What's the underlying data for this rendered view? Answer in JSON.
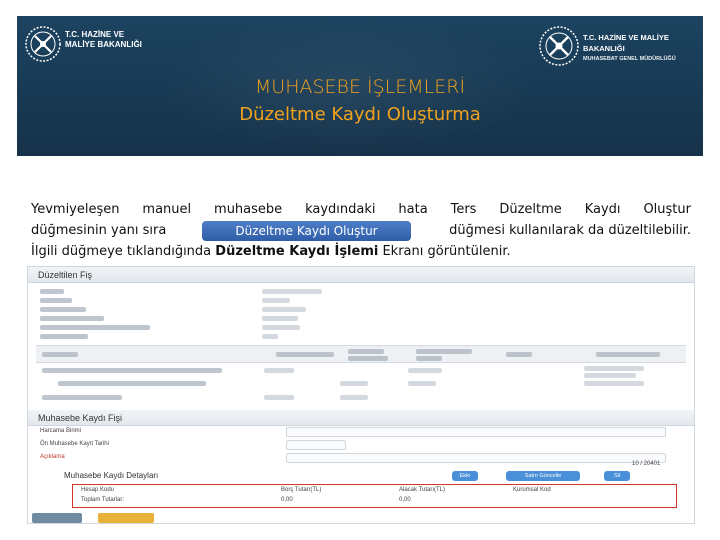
{
  "header": {
    "left_ministry_line1": "T.C. HAZİNE VE",
    "left_ministry_line2": "MALİYE BAKANLIĞI",
    "right_ministry_line1": "T.C. HAZİNE VE MALİYE BAKANLIĞI",
    "right_ministry_line2": "MUHASEBAT GENEL MÜDÜRLÜĞÜ",
    "title": "MUHASEBE İŞLEMLERİ",
    "subtitle": "Düzeltme Kaydı Oluşturma",
    "colors": {
      "band": "#18374f",
      "title": "#f0a21c"
    }
  },
  "paragraph": {
    "line1_words": [
      "Yevmiyeleşen",
      "manuel",
      "muhasebe",
      "kaydındaki",
      "hata",
      "Ters",
      "Düzeltme",
      "Kaydı",
      "Oluştur"
    ],
    "line2_left": "düğmesinin yanı sıra",
    "button_label": "Düzeltme Kaydı Oluştur",
    "line2_right": "düğmesi kullanılarak da düzeltilebilir.",
    "line3_pre": "İlgili düğmeye tıklandığında ",
    "line3_bold": "Düzeltme Kaydı İşlemi",
    "line3_post": " Ekranı görüntülenir."
  },
  "screenshot": {
    "section1_title": "Düzeltilen Fiş",
    "section2_title": "Muhasebe Kaydı Fişi",
    "section2_rows": [
      "Harcama Birimi",
      "Ön Muhasebe Kayıt Tarihi",
      "Açıklama"
    ],
    "detail_title": "Muhasebe Kaydı Detayları",
    "detail_headers": [
      "Hesap Kodu",
      "Borç Tutarı(TL)",
      "Alacak Tutarı(TL)",
      "Kurumsal Kod"
    ],
    "detail_total_label": "Toplam Tutarlar:",
    "detail_total_debit": "0,00",
    "detail_total_credit": "0,00",
    "detail_buttons": [
      "Ekle",
      "Satırı Güncelle",
      "Sil"
    ],
    "page_indicator": "10 / 20401"
  }
}
